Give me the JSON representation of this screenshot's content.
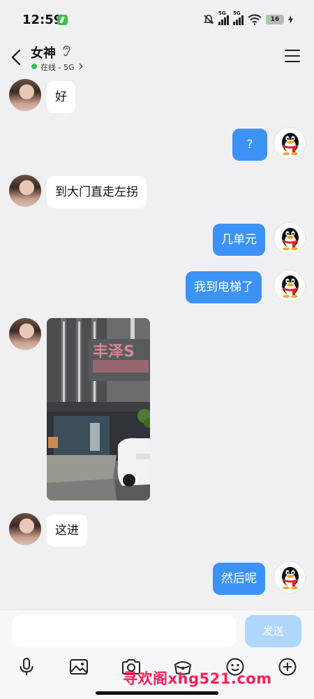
{
  "status_bar": {
    "time": "12:59",
    "network_1": "5G",
    "network_2": "5G",
    "battery": "16"
  },
  "header": {
    "title": "女神",
    "status": "在线 - 5G"
  },
  "messages": [
    {
      "side": "in",
      "text": "好"
    },
    {
      "side": "out",
      "text": "?"
    },
    {
      "side": "in",
      "text": "到大门直走左拐"
    },
    {
      "side": "out",
      "text": "几单元"
    },
    {
      "side": "out",
      "text": "我到电梯了"
    },
    {
      "side": "in",
      "type": "image",
      "sign_text": "丰泽S"
    },
    {
      "side": "in",
      "text": "这进"
    },
    {
      "side": "out",
      "text": "然后呢"
    }
  ],
  "input": {
    "value": "",
    "send_label": "发送"
  },
  "toolbar": [
    "microphone-icon",
    "image-icon",
    "camera-icon",
    "red-packet-icon",
    "emoji-icon",
    "plus-icon"
  ],
  "watermark": "寻欢阁xhg521.com",
  "colors": {
    "background": "#f0f0f3",
    "outgoing_bubble": "#3d93f5",
    "incoming_bubble": "#ffffff",
    "send_button": "#b1d6fb",
    "online_dot": "#37c25b",
    "watermark": "#ff1e56"
  }
}
